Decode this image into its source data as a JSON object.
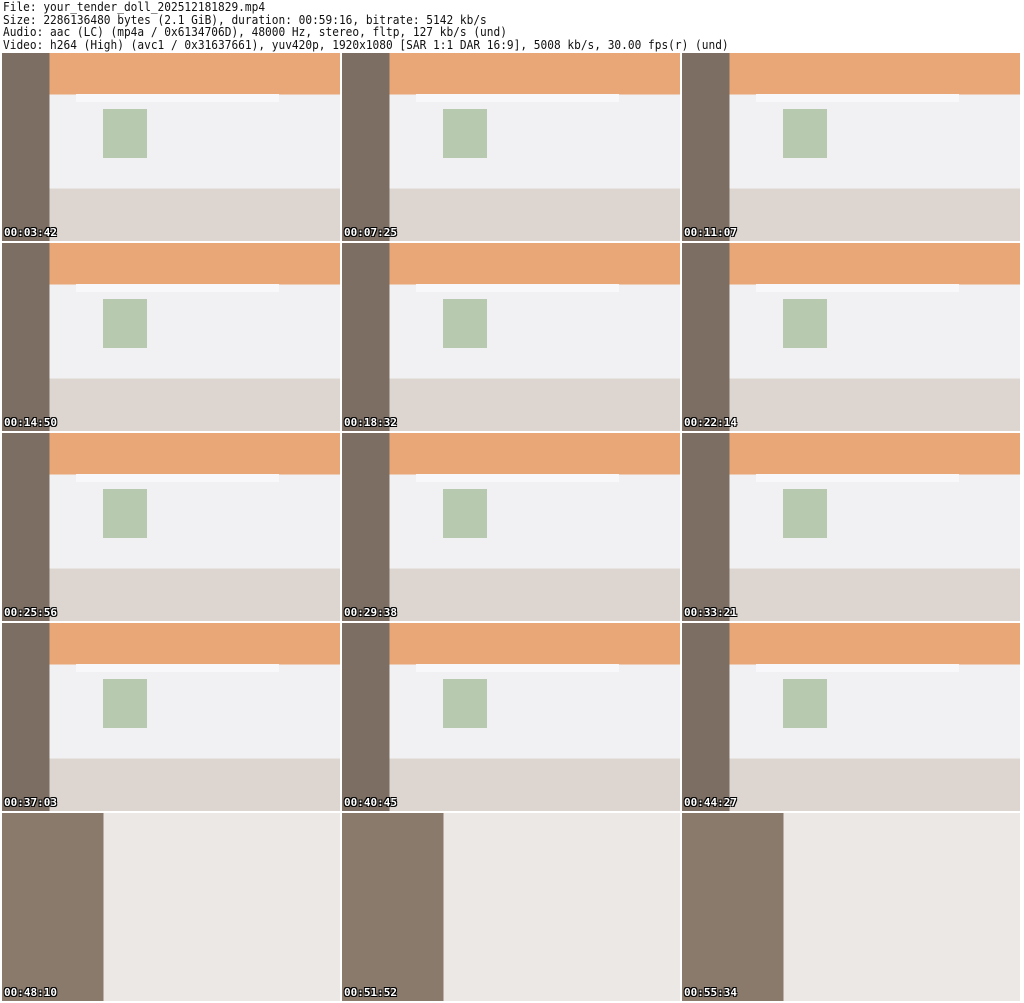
{
  "header": {
    "file": "File: your_tender_doll_202512181829.mp4",
    "size": "Size: 2286136480 bytes (2.1 GiB), duration: 00:59:16, bitrate: 5142 kb/s",
    "audio": "Audio: aac (LC) (mp4a / 0x6134706D), 48000 Hz, stereo, fltp, 127 kb/s (und)",
    "video": "Video: h264 (High) (avc1 / 0x31637661), yuv420p, 1920x1080 [SAR 1:1 DAR 16:9], 5008 kb/s, 30.00 fps(r) (und)"
  },
  "thumbnails": [
    {
      "time": "00:03:42"
    },
    {
      "time": "00:07:25"
    },
    {
      "time": "00:11:07"
    },
    {
      "time": "00:14:50"
    },
    {
      "time": "00:18:32"
    },
    {
      "time": "00:22:14"
    },
    {
      "time": "00:25:56"
    },
    {
      "time": "00:29:38"
    },
    {
      "time": "00:33:21"
    },
    {
      "time": "00:37:03"
    },
    {
      "time": "00:40:45"
    },
    {
      "time": "00:44:27"
    },
    {
      "time": "00:48:10"
    },
    {
      "time": "00:51:52"
    },
    {
      "time": "00:55:34"
    }
  ]
}
